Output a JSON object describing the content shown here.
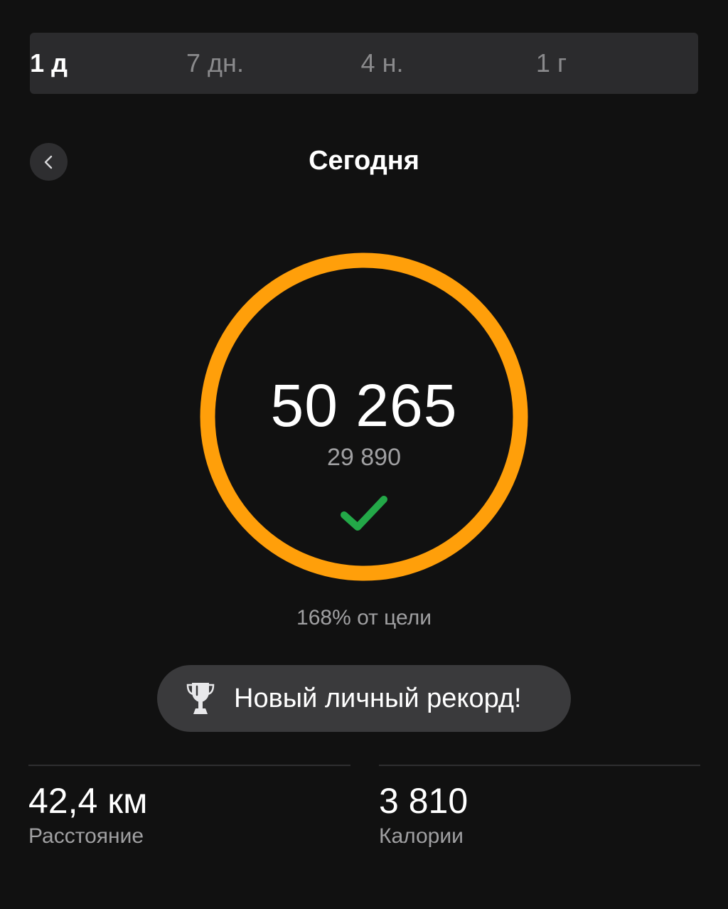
{
  "period_tabs": [
    {
      "label": "1 д",
      "active": true
    },
    {
      "label": "7 дн.",
      "active": false
    },
    {
      "label": "4 н.",
      "active": false
    },
    {
      "label": "1 г",
      "active": false
    }
  ],
  "header": {
    "back_icon": "chevron-left-icon",
    "title": "Сегодня"
  },
  "ring": {
    "steps": "50 265",
    "goal": "29 890",
    "progress": 1.68,
    "color": "#ff9f0a",
    "check_icon": "checkmark-icon",
    "check_color": "#23a848"
  },
  "goal_percent": "168% от цели",
  "record": {
    "icon": "trophy-icon",
    "text": "Новый личный рекорд!"
  },
  "stats": {
    "distance": {
      "value": "42,4 км",
      "label": "Расстояние"
    },
    "calories": {
      "value": "3 810",
      "label": "Калории"
    }
  }
}
